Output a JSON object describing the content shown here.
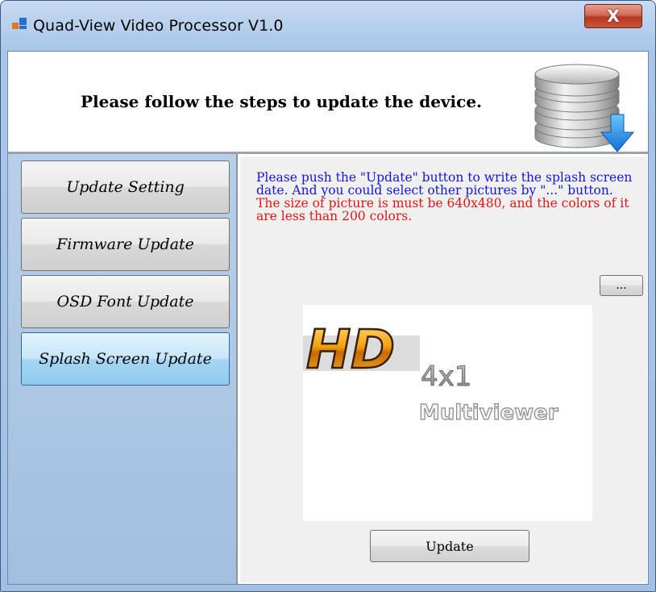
{
  "window": {
    "title": "Quad-View Video Processor V1.0",
    "close_label": "X"
  },
  "header": {
    "instruction": "Please follow the steps to update the device."
  },
  "sidebar": {
    "items": [
      {
        "label": "Update Setting",
        "active": false
      },
      {
        "label": "Firmware Update",
        "active": false
      },
      {
        "label": "OSD Font Update",
        "active": false
      },
      {
        "label": "Splash Screen Update",
        "active": true
      }
    ]
  },
  "content": {
    "info_blue": "Please push the \"Update\" button to write the splash screen date. And you could select other pictures by \"...\" button.",
    "info_red": "The size of picture is must be 640x480, and the colors of it are less than 200 colors.",
    "browse_label": "...",
    "preview": {
      "logo_hd": "HD",
      "logo_4x1": "4x1",
      "logo_multiviewer": "Multiviewer"
    },
    "update_label": "Update"
  },
  "colors": {
    "accent_active": "#a6d6f2",
    "info_blue": "#1414e6",
    "info_red": "#e61414"
  }
}
